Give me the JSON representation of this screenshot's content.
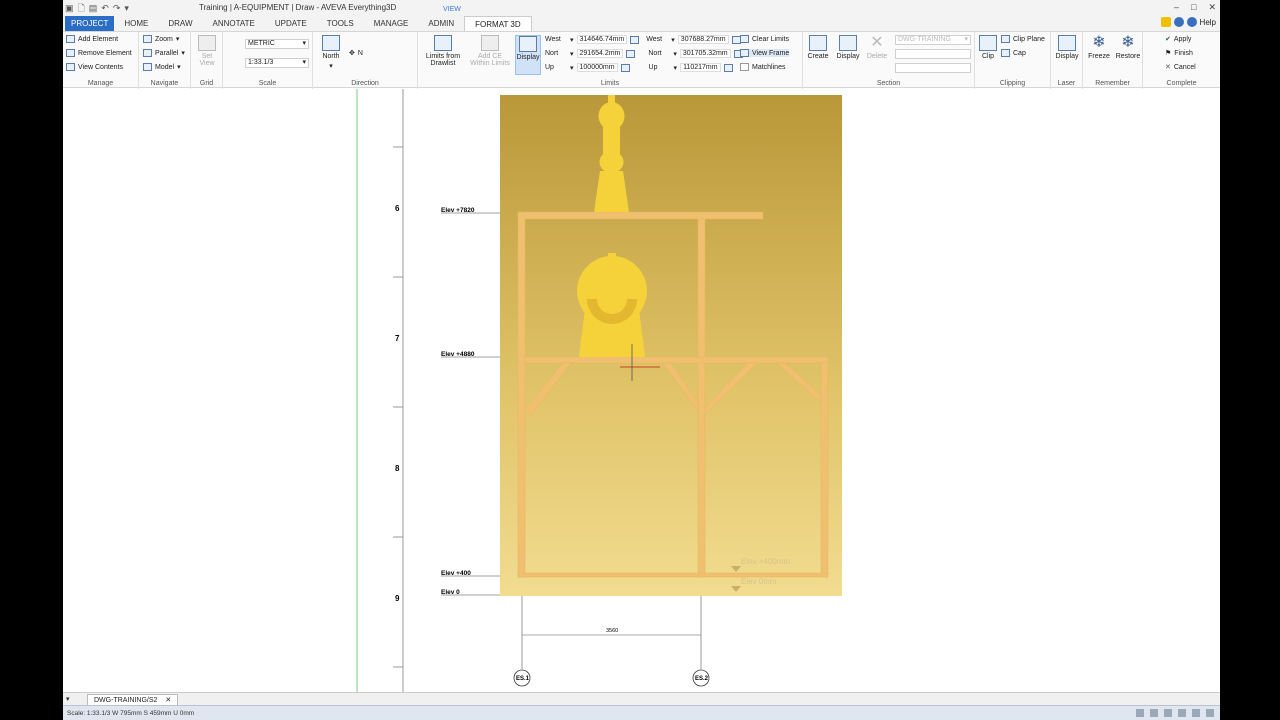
{
  "window": {
    "title": "Training | A-EQUIPMENT | Draw - AVEVA Everything3D",
    "controls": [
      "–",
      "□",
      "✕"
    ]
  },
  "tabs": {
    "items": [
      "PROJECT",
      "HOME",
      "DRAW",
      "ANNOTATE",
      "UPDATE",
      "TOOLS",
      "MANAGE",
      "ADMIN",
      "FORMAT 3D"
    ],
    "context_label": "VIEW",
    "help_label": "Help"
  },
  "ribbon": {
    "manage": {
      "add_element": "Add Element",
      "remove_element": "Remove Element",
      "view_contents": "View Contents",
      "label": "Manage"
    },
    "navigate": {
      "zoom": "Zoom",
      "parallel": "Parallel",
      "model": "Model",
      "label": "Navigate"
    },
    "grid": {
      "set_view": "Set View",
      "label": "Grid"
    },
    "scale": {
      "units": "METRIC",
      "ratio": "1:33.1/3",
      "label": "Scale"
    },
    "direction": {
      "north": "North",
      "n": "N",
      "label": "Direction"
    },
    "limits": {
      "limits_from_drawlist": "Limits from Drawlist",
      "add_ce_within_limits": "Add CE Within Limits",
      "display": "Display",
      "row1": {
        "a_label": "West",
        "a_value": "314646.74mm",
        "b_label": "West",
        "b_value": "307688.27mm"
      },
      "row2": {
        "a_label": "Nort",
        "a_value": "291654.2mm",
        "b_label": "Nort",
        "b_value": "301705.32mm"
      },
      "row3": {
        "a_label": "Up",
        "a_value": "100000mm",
        "b_label": "Up",
        "b_value": "110217mm"
      },
      "clear_limits": "Clear Limits",
      "view_frame": "View Frame",
      "matchlines": "Matchlines",
      "label": "Limits"
    },
    "section": {
      "create": "Create",
      "display": "Display",
      "delete": "Delete",
      "combo": "DWG-TRAINING",
      "label": "Section"
    },
    "clipping": {
      "clip": "Clip",
      "clip_plane": "Clip Plane",
      "cap": "Cap",
      "label": "Clipping"
    },
    "laser": {
      "display": "Display",
      "label": "Laser"
    },
    "remember": {
      "freeze": "Freeze",
      "restore": "Restore",
      "label": "Remember"
    },
    "complete": {
      "apply": "Apply",
      "finish": "Finish",
      "cancel": "Cancel",
      "label": "Complete"
    }
  },
  "drawing": {
    "row_numbers": [
      "6",
      "7",
      "8",
      "9"
    ],
    "elev_left": [
      "Elev +7820",
      "Elev +4880",
      "Elev +400",
      "Elev 0"
    ],
    "elev_right": [
      "Elev +400mm",
      "Elev 0mm"
    ],
    "dimension": "3560",
    "grid_markers": [
      "ES.1",
      "ES.2"
    ],
    "colors": {
      "frame": "#f0c070",
      "equipment": "#f6d23a",
      "background_top": "#b89838",
      "background_bottom": "#f1dc90"
    }
  },
  "doc_tab": {
    "label": "DWG-TRAINING/S2",
    "close": "✕"
  },
  "status": {
    "text": "Scale: 1:33.1/3  W 795mm S 459mm U 0mm"
  }
}
